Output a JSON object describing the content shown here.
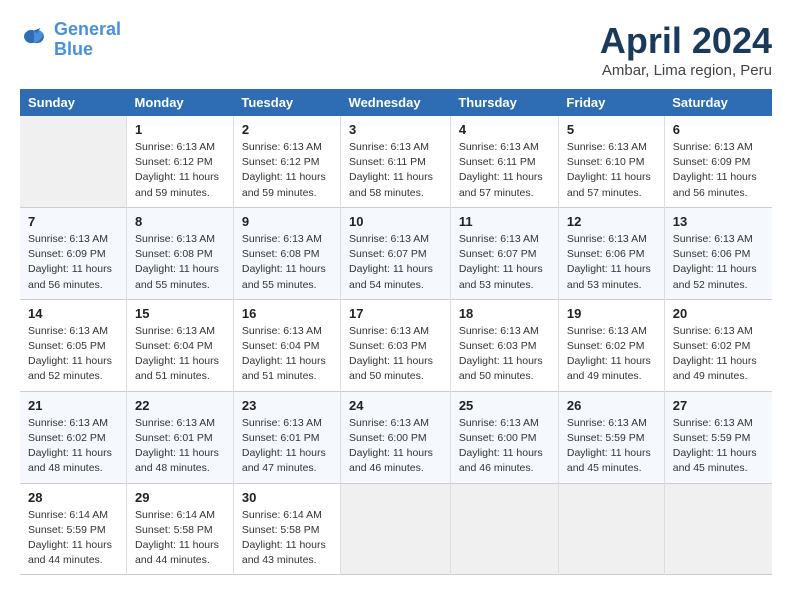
{
  "header": {
    "logo_line1": "General",
    "logo_line2": "Blue",
    "month_year": "April 2024",
    "location": "Ambar, Lima region, Peru"
  },
  "weekdays": [
    "Sunday",
    "Monday",
    "Tuesday",
    "Wednesday",
    "Thursday",
    "Friday",
    "Saturday"
  ],
  "weeks": [
    [
      {
        "day": "",
        "empty": true
      },
      {
        "day": "1",
        "sunrise": "6:13 AM",
        "sunset": "6:12 PM",
        "daylight": "11 hours and 59 minutes."
      },
      {
        "day": "2",
        "sunrise": "6:13 AM",
        "sunset": "6:12 PM",
        "daylight": "11 hours and 59 minutes."
      },
      {
        "day": "3",
        "sunrise": "6:13 AM",
        "sunset": "6:11 PM",
        "daylight": "11 hours and 58 minutes."
      },
      {
        "day": "4",
        "sunrise": "6:13 AM",
        "sunset": "6:11 PM",
        "daylight": "11 hours and 57 minutes."
      },
      {
        "day": "5",
        "sunrise": "6:13 AM",
        "sunset": "6:10 PM",
        "daylight": "11 hours and 57 minutes."
      },
      {
        "day": "6",
        "sunrise": "6:13 AM",
        "sunset": "6:09 PM",
        "daylight": "11 hours and 56 minutes."
      }
    ],
    [
      {
        "day": "7",
        "sunrise": "6:13 AM",
        "sunset": "6:09 PM",
        "daylight": "11 hours and 56 minutes."
      },
      {
        "day": "8",
        "sunrise": "6:13 AM",
        "sunset": "6:08 PM",
        "daylight": "11 hours and 55 minutes."
      },
      {
        "day": "9",
        "sunrise": "6:13 AM",
        "sunset": "6:08 PM",
        "daylight": "11 hours and 55 minutes."
      },
      {
        "day": "10",
        "sunrise": "6:13 AM",
        "sunset": "6:07 PM",
        "daylight": "11 hours and 54 minutes."
      },
      {
        "day": "11",
        "sunrise": "6:13 AM",
        "sunset": "6:07 PM",
        "daylight": "11 hours and 53 minutes."
      },
      {
        "day": "12",
        "sunrise": "6:13 AM",
        "sunset": "6:06 PM",
        "daylight": "11 hours and 53 minutes."
      },
      {
        "day": "13",
        "sunrise": "6:13 AM",
        "sunset": "6:06 PM",
        "daylight": "11 hours and 52 minutes."
      }
    ],
    [
      {
        "day": "14",
        "sunrise": "6:13 AM",
        "sunset": "6:05 PM",
        "daylight": "11 hours and 52 minutes."
      },
      {
        "day": "15",
        "sunrise": "6:13 AM",
        "sunset": "6:04 PM",
        "daylight": "11 hours and 51 minutes."
      },
      {
        "day": "16",
        "sunrise": "6:13 AM",
        "sunset": "6:04 PM",
        "daylight": "11 hours and 51 minutes."
      },
      {
        "day": "17",
        "sunrise": "6:13 AM",
        "sunset": "6:03 PM",
        "daylight": "11 hours and 50 minutes."
      },
      {
        "day": "18",
        "sunrise": "6:13 AM",
        "sunset": "6:03 PM",
        "daylight": "11 hours and 50 minutes."
      },
      {
        "day": "19",
        "sunrise": "6:13 AM",
        "sunset": "6:02 PM",
        "daylight": "11 hours and 49 minutes."
      },
      {
        "day": "20",
        "sunrise": "6:13 AM",
        "sunset": "6:02 PM",
        "daylight": "11 hours and 49 minutes."
      }
    ],
    [
      {
        "day": "21",
        "sunrise": "6:13 AM",
        "sunset": "6:02 PM",
        "daylight": "11 hours and 48 minutes."
      },
      {
        "day": "22",
        "sunrise": "6:13 AM",
        "sunset": "6:01 PM",
        "daylight": "11 hours and 48 minutes."
      },
      {
        "day": "23",
        "sunrise": "6:13 AM",
        "sunset": "6:01 PM",
        "daylight": "11 hours and 47 minutes."
      },
      {
        "day": "24",
        "sunrise": "6:13 AM",
        "sunset": "6:00 PM",
        "daylight": "11 hours and 46 minutes."
      },
      {
        "day": "25",
        "sunrise": "6:13 AM",
        "sunset": "6:00 PM",
        "daylight": "11 hours and 46 minutes."
      },
      {
        "day": "26",
        "sunrise": "6:13 AM",
        "sunset": "5:59 PM",
        "daylight": "11 hours and 45 minutes."
      },
      {
        "day": "27",
        "sunrise": "6:13 AM",
        "sunset": "5:59 PM",
        "daylight": "11 hours and 45 minutes."
      }
    ],
    [
      {
        "day": "28",
        "sunrise": "6:14 AM",
        "sunset": "5:59 PM",
        "daylight": "11 hours and 44 minutes."
      },
      {
        "day": "29",
        "sunrise": "6:14 AM",
        "sunset": "5:58 PM",
        "daylight": "11 hours and 44 minutes."
      },
      {
        "day": "30",
        "sunrise": "6:14 AM",
        "sunset": "5:58 PM",
        "daylight": "11 hours and 43 minutes."
      },
      {
        "day": "",
        "empty": true
      },
      {
        "day": "",
        "empty": true
      },
      {
        "day": "",
        "empty": true
      },
      {
        "day": "",
        "empty": true
      }
    ]
  ]
}
